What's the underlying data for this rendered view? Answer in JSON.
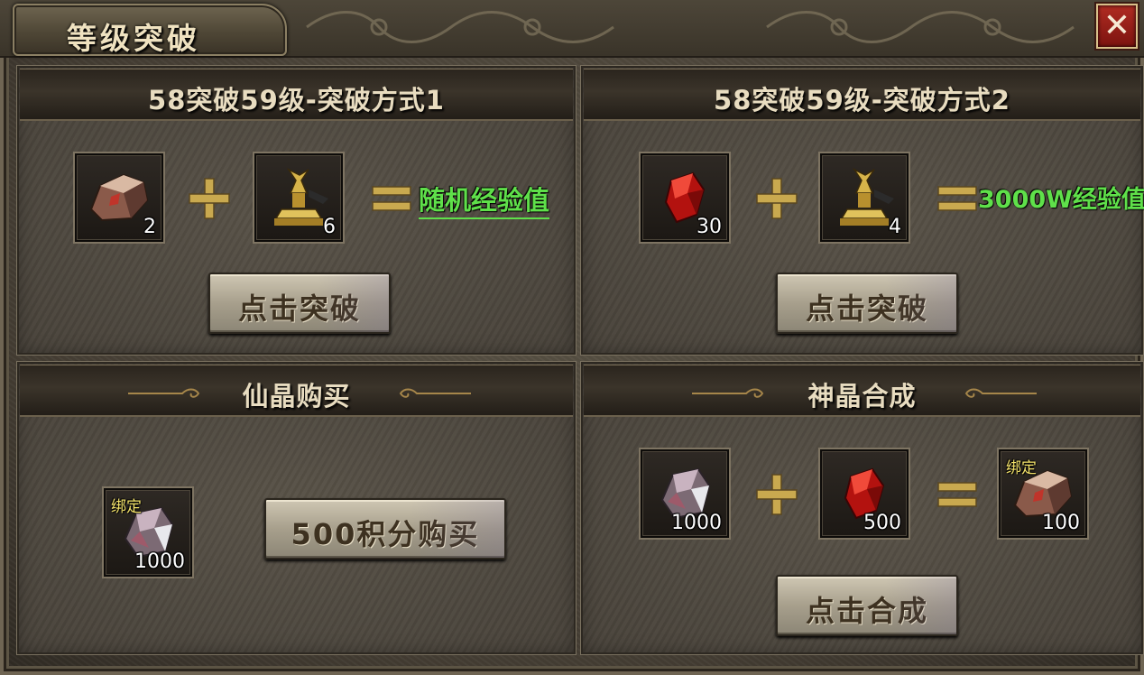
{
  "window": {
    "title": "等级突破",
    "close_label": "✕"
  },
  "panels": {
    "method1": {
      "title": "58突破59级-突破方式1",
      "items": [
        {
          "icon": "immortal-crystal-icon",
          "count": "2"
        },
        {
          "icon": "golden-trophy-icon",
          "count": "6"
        }
      ],
      "plus": "+",
      "equals": "=",
      "result": "随机经验值",
      "button_label": "点击突破"
    },
    "method2": {
      "title": "58突破59级-突破方式2",
      "items": [
        {
          "icon": "red-gem-icon",
          "count": "30"
        },
        {
          "icon": "golden-trophy-icon",
          "count": "4"
        }
      ],
      "plus": "+",
      "equals": "=",
      "result": "3000W经验值",
      "button_label": "点击突破"
    },
    "purchase": {
      "title": "仙晶购买",
      "item": {
        "icon": "quartz-crystal-icon",
        "tag": "绑定",
        "count": "1000"
      },
      "button_label": "500积分购买"
    },
    "synthesis": {
      "title": "神晶合成",
      "items": [
        {
          "icon": "quartz-crystal-icon",
          "count": "1000"
        },
        {
          "icon": "red-gem-icon",
          "count": "500"
        }
      ],
      "result_item": {
        "icon": "immortal-crystal-icon",
        "tag": "绑定",
        "count": "100"
      },
      "button_label": "点击合成"
    }
  },
  "colors": {
    "result_green": "#5fe04a",
    "gold": "#c9a94f",
    "close_red": "#9c1f18"
  }
}
